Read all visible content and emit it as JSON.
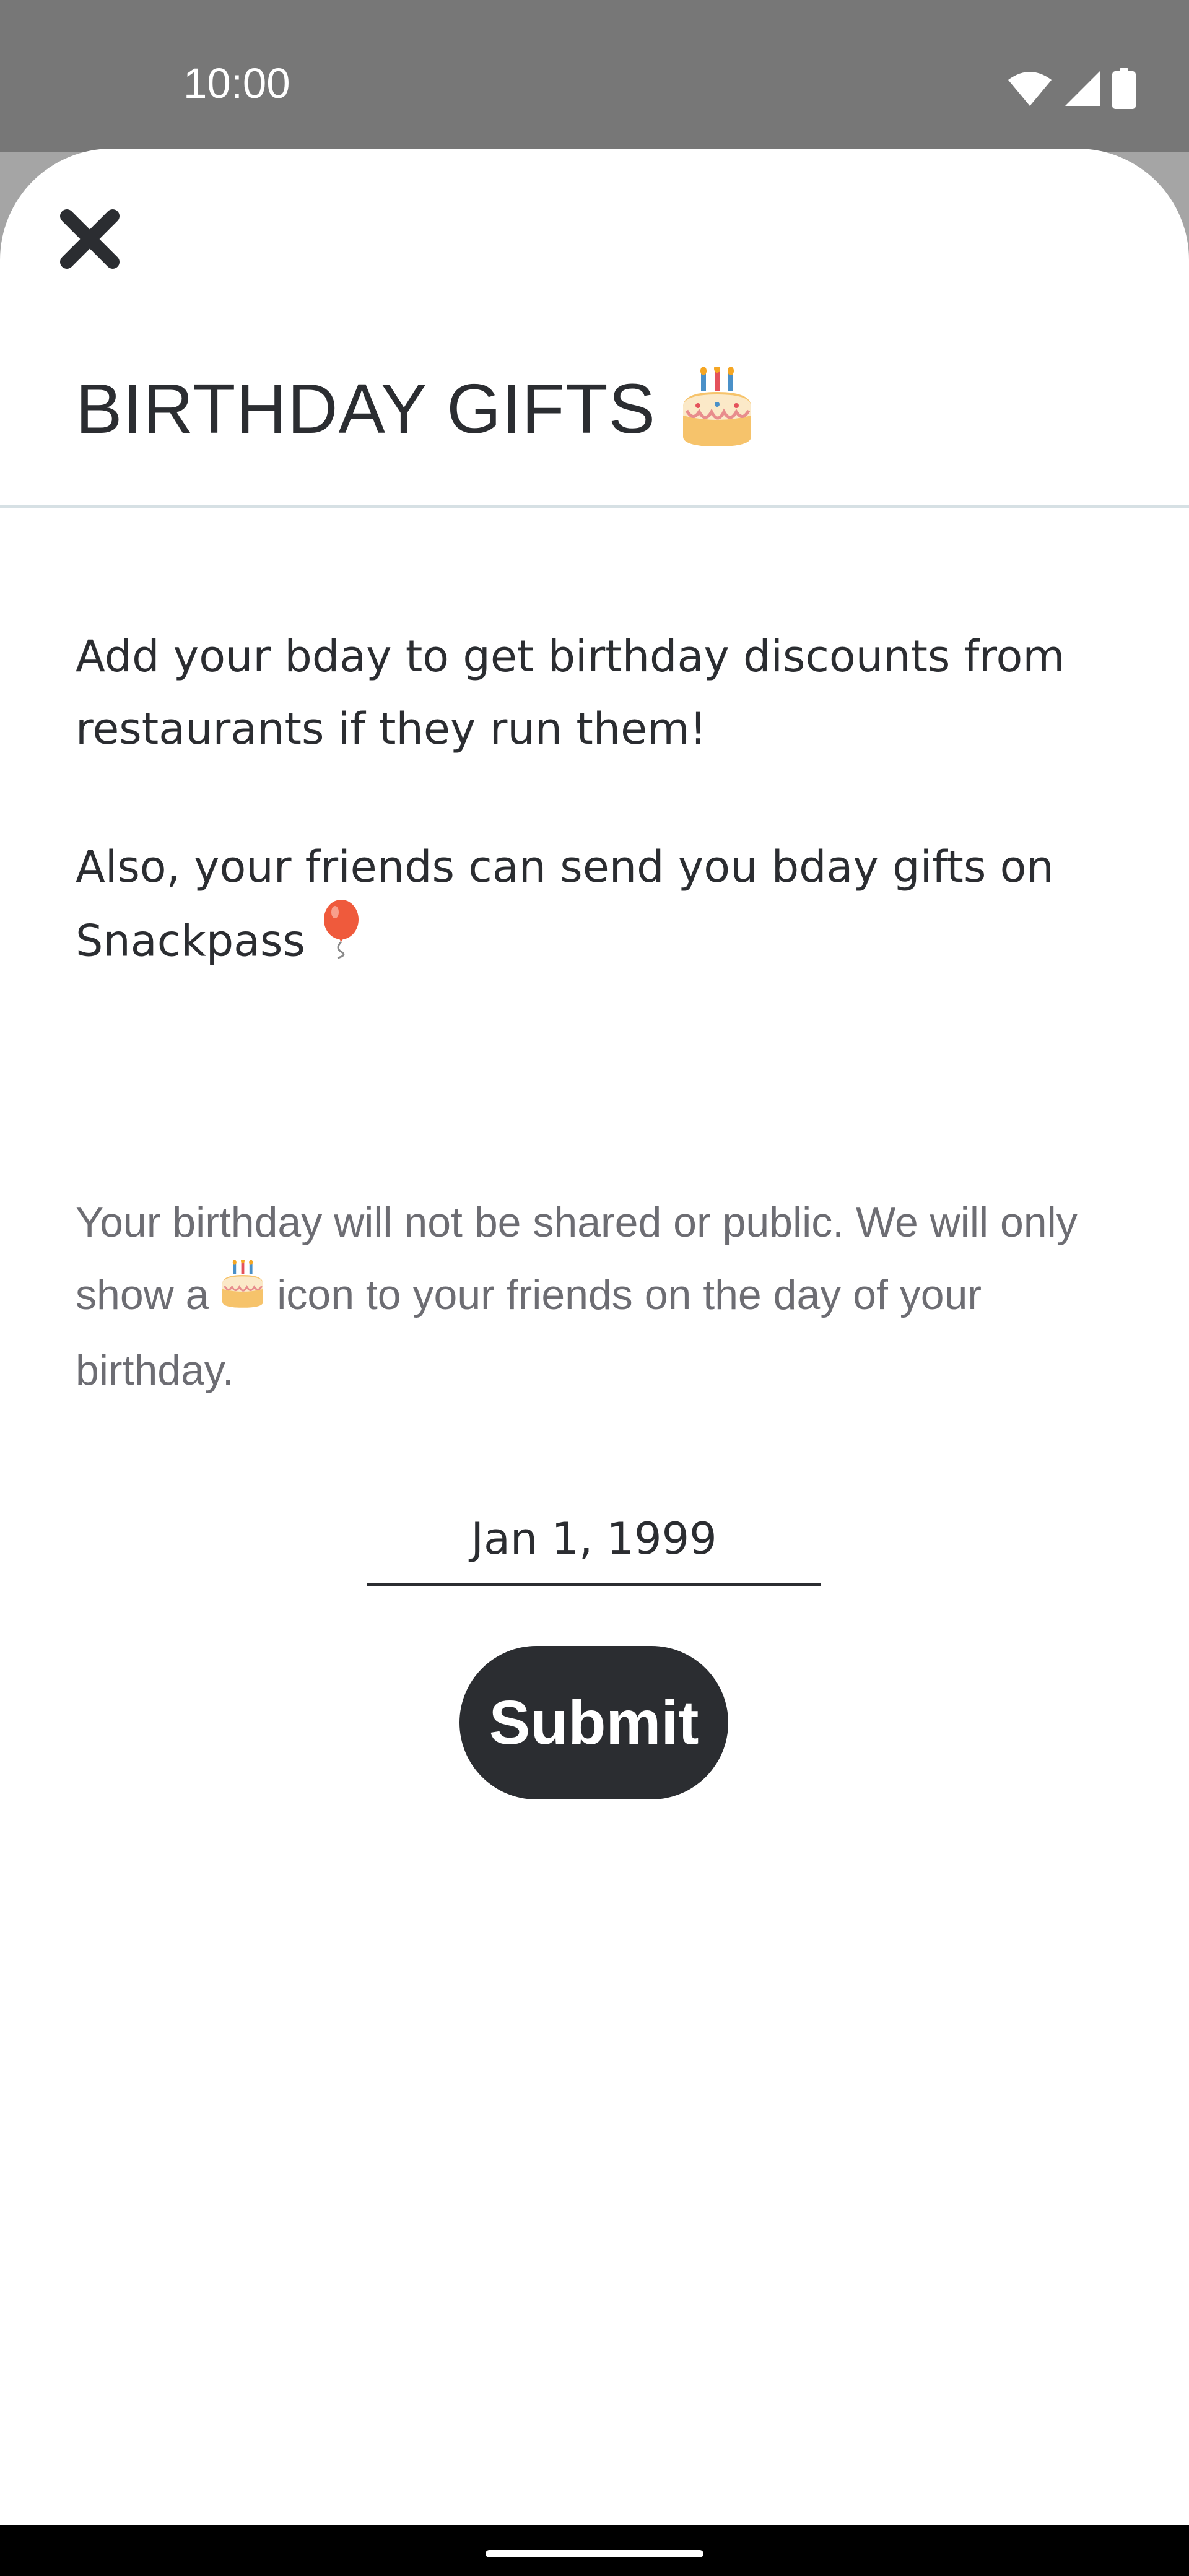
{
  "status_bar": {
    "time": "10:00",
    "icons": [
      "wifi-icon",
      "cell-signal-icon",
      "battery-icon"
    ]
  },
  "sheet": {
    "close_icon": "close-icon",
    "title": "BIRTHDAY GIFTS",
    "title_icon": "birthday-cake-icon",
    "para1": "Add your bday to get birthday discounts from restaurants if they run them!",
    "para2": "Also, your friends can send you bday gifts on Snackpass",
    "para2_icon": "balloon-icon",
    "para3_part1": "Your birthday will not be shared or public. We will only show a",
    "para3_icon": "birthday-cake-icon",
    "para3_part2": "icon to your friends on the day of your birthday.",
    "birthday_value": "Jan 1, 1999",
    "submit_label": "Submit"
  },
  "colors": {
    "status_bar_bg": "#777777",
    "primary_text": "#2b2d31",
    "secondary_text": "#6d6d73",
    "button_bg": "#2b2d31",
    "divider": "#d6e0e4"
  }
}
